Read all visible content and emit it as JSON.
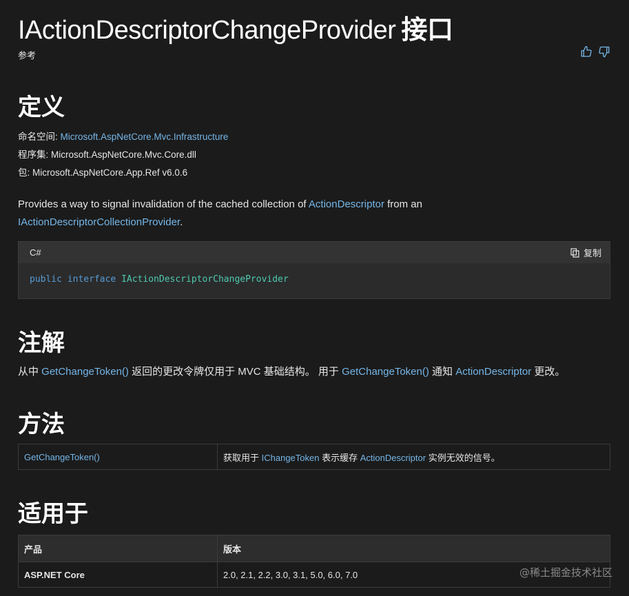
{
  "header": {
    "title": "IActionDescriptorChangeProvider",
    "title_suffix": "接口",
    "ref_label": "参考"
  },
  "definition": {
    "heading": "定义",
    "namespace_label": "命名空间:",
    "namespace_value": "Microsoft.AspNetCore.Mvc.Infrastructure",
    "assembly_label": "程序集:",
    "assembly_value": "Microsoft.AspNetCore.Mvc.Core.dll",
    "package_label": "包:",
    "package_value": "Microsoft.AspNetCore.App.Ref v6.0.6",
    "summary_prefix": "Provides a way to signal invalidation of the cached collection of ",
    "summary_link1": "ActionDescriptor",
    "summary_middle": " from an ",
    "summary_link2": "IActionDescriptorCollectionProvider",
    "summary_suffix": "."
  },
  "code": {
    "language": "C#",
    "copy_label": "复制",
    "kw_public": "public",
    "kw_interface": "interface",
    "type_name": "IActionDescriptorChangeProvider"
  },
  "remarks": {
    "heading": "注解",
    "part1": "从中 ",
    "link1": "GetChangeToken()",
    "part2": " 返回的更改令牌仅用于 MVC 基础结构。 用于 ",
    "link2": "GetChangeToken()",
    "part3": " 通知 ",
    "link3": "ActionDescriptor",
    "part4": " 更改。"
  },
  "methods": {
    "heading": "方法",
    "rows": [
      {
        "name": "GetChangeToken()",
        "desc_part1": "获取用于 ",
        "desc_link1": "IChangeToken",
        "desc_part2": " 表示缓存 ",
        "desc_link2": "ActionDescriptor",
        "desc_part3": " 实例无效的信号。"
      }
    ]
  },
  "applies_to": {
    "heading": "适用于",
    "col_product": "产品",
    "col_version": "版本",
    "rows": [
      {
        "product": "ASP.NET Core",
        "versions": "2.0, 2.1, 2.2, 3.0, 3.1, 5.0, 6.0, 7.0"
      }
    ]
  },
  "watermark": "@稀土掘金技术社区",
  "colors": {
    "background": "#1b1b1b",
    "link": "#75b6e7",
    "keyword": "#569cd6",
    "type": "#4ec9b0",
    "code_bg": "#2b2b2b"
  }
}
